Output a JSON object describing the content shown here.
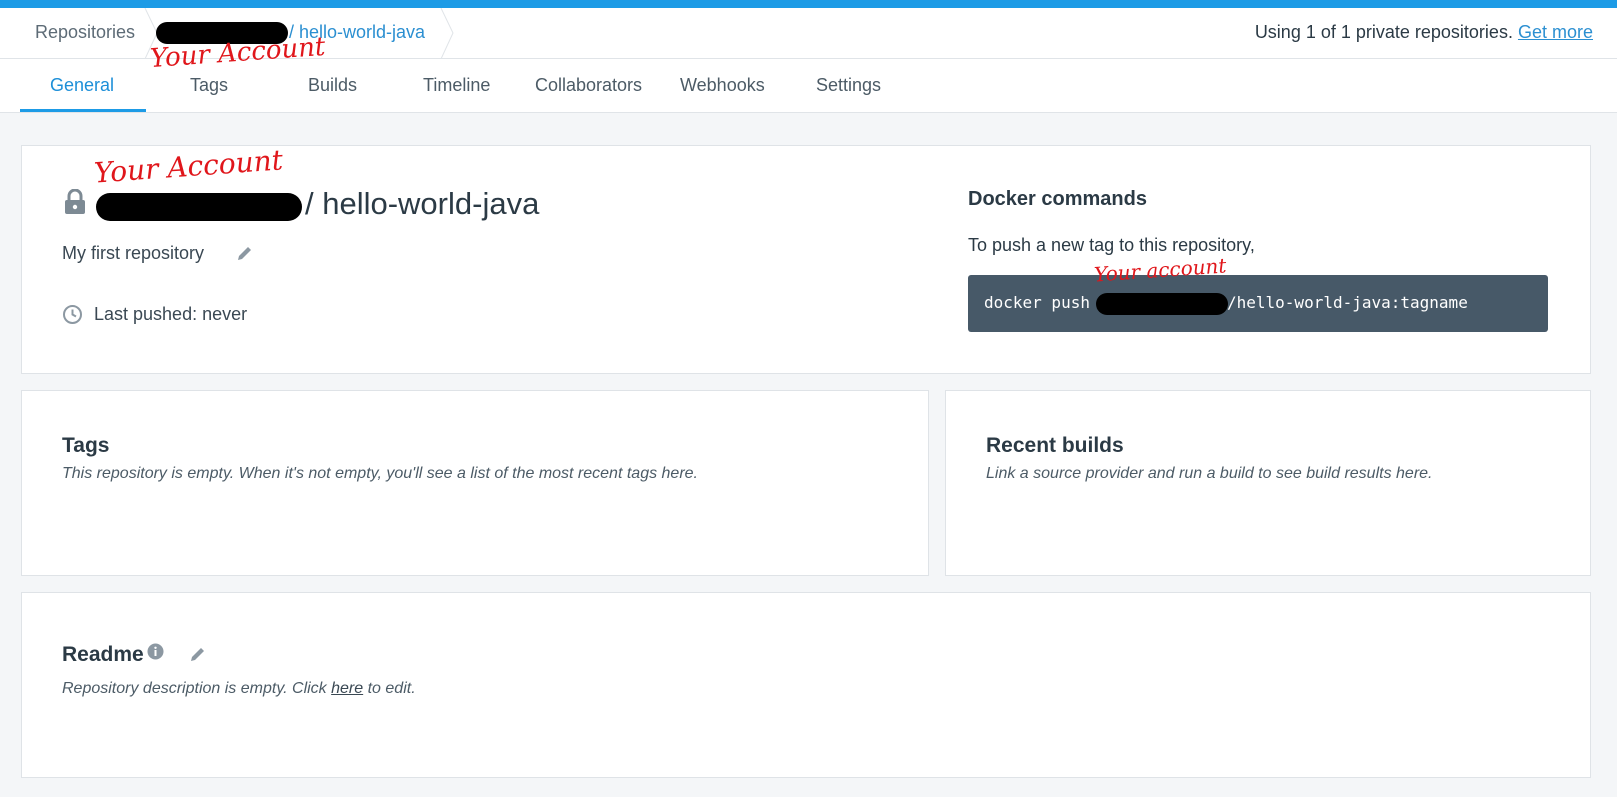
{
  "header": {
    "breadcrumb_root": "Repositories",
    "breadcrumb_repo": "/ hello-world-java",
    "usage_text": "Using 1 of 1 private repositories.",
    "usage_link": "Get more"
  },
  "tabs": [
    {
      "label": "General",
      "active": true
    },
    {
      "label": "Tags"
    },
    {
      "label": "Builds"
    },
    {
      "label": "Timeline"
    },
    {
      "label": "Collaborators"
    },
    {
      "label": "Webhooks"
    },
    {
      "label": "Settings"
    }
  ],
  "repo": {
    "name": "/ hello-world-java",
    "description": "My first repository",
    "last_pushed": "Last pushed: never"
  },
  "docker_commands": {
    "title": "Docker commands",
    "subtitle": "To push a new tag to this repository,",
    "command_prefix": "docker push",
    "command_suffix": "/hello-world-java:tagname"
  },
  "tags_section": {
    "title": "Tags",
    "note": "This repository is empty. When it's not empty, you'll see a list of the most recent tags here."
  },
  "builds_section": {
    "title": "Recent builds",
    "note": "Link a source provider and run a build to see build results here."
  },
  "readme_section": {
    "title": "Readme",
    "note_before": "Repository description is empty. Click ",
    "note_link": "here",
    "note_after": " to edit."
  },
  "annotations": {
    "breadcrumb": "Your Account",
    "title": "Your Account",
    "command": "Your account"
  },
  "colors": {
    "accent": "#1d9be6",
    "command_bg": "#475968",
    "annotation": "#e0161b"
  }
}
